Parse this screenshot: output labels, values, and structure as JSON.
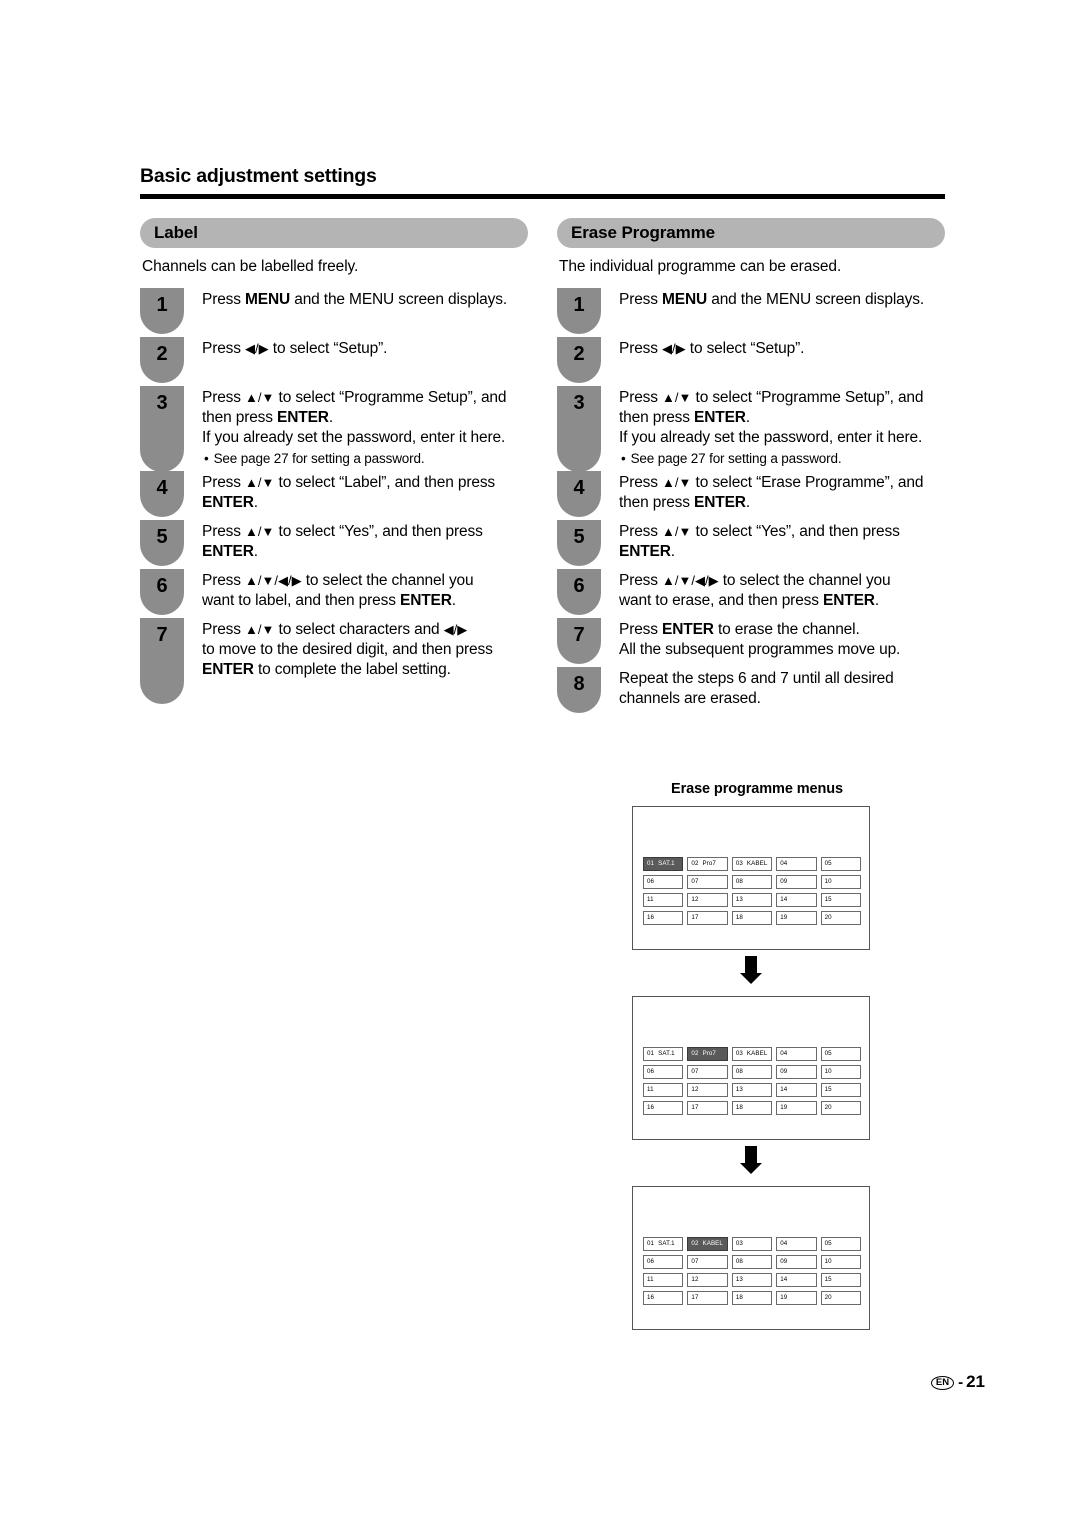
{
  "header": {
    "title": "Basic adjustment settings"
  },
  "left_section": {
    "title": "Label",
    "intro": "Channels can be labelled freely.",
    "steps": [
      {
        "number": "1",
        "size": "sm",
        "lines": [
          [
            {
              "t": "Press ",
              "b": false
            },
            {
              "t": "MENU",
              "b": true
            },
            {
              "t": " and the MENU screen displays.",
              "b": false
            }
          ]
        ]
      },
      {
        "number": "2",
        "size": "sm",
        "lines": [
          [
            {
              "t": "Press ",
              "b": false
            },
            {
              "t": "◀/▶",
              "b": false,
              "arrow": true
            },
            {
              "t": " to select “Setup”.",
              "b": false
            }
          ]
        ]
      },
      {
        "number": "3",
        "size": "lg",
        "lines": [
          [
            {
              "t": "Press ",
              "b": false
            },
            {
              "t": "▲/▼",
              "b": false,
              "arrow": true
            },
            {
              "t": " to select “Programme Setup”, and",
              "b": false
            }
          ],
          [
            {
              "t": "then press ",
              "b": false
            },
            {
              "t": "ENTER",
              "b": true
            },
            {
              "t": ".",
              "b": false
            }
          ],
          [
            {
              "t": "If you already set the password, enter it here.",
              "b": false
            }
          ]
        ],
        "note": "See page 27 for setting a password."
      },
      {
        "number": "4",
        "size": "md",
        "lines": [
          [
            {
              "t": "Press ",
              "b": false
            },
            {
              "t": "▲/▼",
              "b": false,
              "arrow": true
            },
            {
              "t": " to select “Label”, and then press",
              "b": false
            }
          ],
          [
            {
              "t": "ENTER",
              "b": true
            },
            {
              "t": ".",
              "b": false
            }
          ]
        ]
      },
      {
        "number": "5",
        "size": "md",
        "lines": [
          [
            {
              "t": "Press ",
              "b": false
            },
            {
              "t": "▲/▼",
              "b": false,
              "arrow": true
            },
            {
              "t": " to select “Yes”, and then press",
              "b": false
            }
          ],
          [
            {
              "t": "ENTER",
              "b": true
            },
            {
              "t": ".",
              "b": false
            }
          ]
        ]
      },
      {
        "number": "6",
        "size": "md",
        "lines": [
          [
            {
              "t": "Press ",
              "b": false
            },
            {
              "t": "▲/▼/◀/▶",
              "b": false,
              "arrow": true
            },
            {
              "t": " to select the channel you",
              "b": false
            }
          ],
          [
            {
              "t": "want to label, and then press ",
              "b": false
            },
            {
              "t": "ENTER",
              "b": true
            },
            {
              "t": ".",
              "b": false
            }
          ]
        ]
      },
      {
        "number": "7",
        "size": "lg",
        "lines": [
          [
            {
              "t": "Press ",
              "b": false
            },
            {
              "t": "▲/▼",
              "b": false,
              "arrow": true
            },
            {
              "t": " to select characters and ",
              "b": false
            },
            {
              "t": "◀/▶",
              "b": false,
              "arrow": true
            }
          ],
          [
            {
              "t": "to move to the desired digit, and then press",
              "b": false
            }
          ],
          [
            {
              "t": "ENTER",
              "b": true
            },
            {
              "t": " to complete the label setting.",
              "b": false
            }
          ]
        ]
      }
    ]
  },
  "right_section": {
    "title": "Erase Programme",
    "intro": "The individual programme can be erased.",
    "steps": [
      {
        "number": "1",
        "size": "sm",
        "lines": [
          [
            {
              "t": "Press ",
              "b": false
            },
            {
              "t": "MENU",
              "b": true
            },
            {
              "t": " and the MENU screen displays.",
              "b": false
            }
          ]
        ]
      },
      {
        "number": "2",
        "size": "sm",
        "lines": [
          [
            {
              "t": "Press ",
              "b": false
            },
            {
              "t": "◀/▶",
              "b": false,
              "arrow": true
            },
            {
              "t": " to select “Setup”.",
              "b": false
            }
          ]
        ]
      },
      {
        "number": "3",
        "size": "lg",
        "lines": [
          [
            {
              "t": "Press ",
              "b": false
            },
            {
              "t": "▲/▼",
              "b": false,
              "arrow": true
            },
            {
              "t": " to select “Programme Setup”, and",
              "b": false
            }
          ],
          [
            {
              "t": "then press ",
              "b": false
            },
            {
              "t": "ENTER",
              "b": true
            },
            {
              "t": ".",
              "b": false
            }
          ],
          [
            {
              "t": "If you already set the password, enter it here.",
              "b": false
            }
          ]
        ],
        "note": "See page 27 for setting a password."
      },
      {
        "number": "4",
        "size": "md",
        "lines": [
          [
            {
              "t": "Press ",
              "b": false
            },
            {
              "t": "▲/▼",
              "b": false,
              "arrow": true
            },
            {
              "t": " to select “Erase Programme”, and",
              "b": false
            }
          ],
          [
            {
              "t": "then press ",
              "b": false
            },
            {
              "t": "ENTER",
              "b": true
            },
            {
              "t": ".",
              "b": false
            }
          ]
        ]
      },
      {
        "number": "5",
        "size": "md",
        "lines": [
          [
            {
              "t": "Press ",
              "b": false
            },
            {
              "t": "▲/▼",
              "b": false,
              "arrow": true
            },
            {
              "t": " to select “Yes”, and then press",
              "b": false
            }
          ],
          [
            {
              "t": "ENTER",
              "b": true
            },
            {
              "t": ".",
              "b": false
            }
          ]
        ]
      },
      {
        "number": "6",
        "size": "md",
        "lines": [
          [
            {
              "t": "Press ",
              "b": false
            },
            {
              "t": "▲/▼/◀/▶",
              "b": false,
              "arrow": true
            },
            {
              "t": " to select the channel you",
              "b": false
            }
          ],
          [
            {
              "t": "want to erase, and then press ",
              "b": false
            },
            {
              "t": "ENTER",
              "b": true
            },
            {
              "t": ".",
              "b": false
            }
          ]
        ]
      },
      {
        "number": "7",
        "size": "md",
        "lines": [
          [
            {
              "t": "Press ",
              "b": false
            },
            {
              "t": "ENTER",
              "b": true
            },
            {
              "t": " to erase the channel.",
              "b": false
            }
          ],
          [
            {
              "t": "All the subsequent programmes move up.",
              "b": false
            }
          ]
        ]
      },
      {
        "number": "8",
        "size": "md",
        "lines": [
          [
            {
              "t": "Repeat the steps 6 and 7 until all desired",
              "b": false
            }
          ],
          [
            {
              "t": "channels are erased.",
              "b": false
            }
          ]
        ]
      }
    ]
  },
  "diagram": {
    "title": "Erase programme menus",
    "arrow_icon": "down-arrow-icon",
    "menus": [
      {
        "name": "menu-before-erase",
        "rows": [
          [
            {
              "num": "01",
              "nm": "SAT.1",
              "sel": true
            },
            {
              "num": "02",
              "nm": "Pro7",
              "sel": false
            },
            {
              "num": "03",
              "nm": "KABEL",
              "sel": false
            },
            {
              "num": "04",
              "nm": "",
              "sel": false
            },
            {
              "num": "05",
              "nm": "",
              "sel": false
            }
          ],
          [
            {
              "num": "06",
              "nm": "",
              "sel": false
            },
            {
              "num": "07",
              "nm": "",
              "sel": false
            },
            {
              "num": "08",
              "nm": "",
              "sel": false
            },
            {
              "num": "09",
              "nm": "",
              "sel": false
            },
            {
              "num": "10",
              "nm": "",
              "sel": false
            }
          ],
          [
            {
              "num": "11",
              "nm": "",
              "sel": false
            },
            {
              "num": "12",
              "nm": "",
              "sel": false
            },
            {
              "num": "13",
              "nm": "",
              "sel": false
            },
            {
              "num": "14",
              "nm": "",
              "sel": false
            },
            {
              "num": "15",
              "nm": "",
              "sel": false
            }
          ],
          [
            {
              "num": "16",
              "nm": "",
              "sel": false
            },
            {
              "num": "17",
              "nm": "",
              "sel": false
            },
            {
              "num": "18",
              "nm": "",
              "sel": false
            },
            {
              "num": "19",
              "nm": "",
              "sel": false
            },
            {
              "num": "20",
              "nm": "",
              "sel": false
            }
          ]
        ]
      },
      {
        "name": "menu-channel-selected",
        "rows": [
          [
            {
              "num": "01",
              "nm": "SAT.1",
              "sel": false
            },
            {
              "num": "02",
              "nm": "Pro7",
              "sel": true
            },
            {
              "num": "03",
              "nm": "KABEL",
              "sel": false
            },
            {
              "num": "04",
              "nm": "",
              "sel": false
            },
            {
              "num": "05",
              "nm": "",
              "sel": false
            }
          ],
          [
            {
              "num": "06",
              "nm": "",
              "sel": false
            },
            {
              "num": "07",
              "nm": "",
              "sel": false
            },
            {
              "num": "08",
              "nm": "",
              "sel": false
            },
            {
              "num": "09",
              "nm": "",
              "sel": false
            },
            {
              "num": "10",
              "nm": "",
              "sel": false
            }
          ],
          [
            {
              "num": "11",
              "nm": "",
              "sel": false
            },
            {
              "num": "12",
              "nm": "",
              "sel": false
            },
            {
              "num": "13",
              "nm": "",
              "sel": false
            },
            {
              "num": "14",
              "nm": "",
              "sel": false
            },
            {
              "num": "15",
              "nm": "",
              "sel": false
            }
          ],
          [
            {
              "num": "16",
              "nm": "",
              "sel": false
            },
            {
              "num": "17",
              "nm": "",
              "sel": false
            },
            {
              "num": "18",
              "nm": "",
              "sel": false
            },
            {
              "num": "19",
              "nm": "",
              "sel": false
            },
            {
              "num": "20",
              "nm": "",
              "sel": false
            }
          ]
        ]
      },
      {
        "name": "menu-after-erase",
        "rows": [
          [
            {
              "num": "01",
              "nm": "SAT.1",
              "sel": false
            },
            {
              "num": "02",
              "nm": "KABEL",
              "sel": true
            },
            {
              "num": "03",
              "nm": "",
              "sel": false
            },
            {
              "num": "04",
              "nm": "",
              "sel": false
            },
            {
              "num": "05",
              "nm": "",
              "sel": false
            }
          ],
          [
            {
              "num": "06",
              "nm": "",
              "sel": false
            },
            {
              "num": "07",
              "nm": "",
              "sel": false
            },
            {
              "num": "08",
              "nm": "",
              "sel": false
            },
            {
              "num": "09",
              "nm": "",
              "sel": false
            },
            {
              "num": "10",
              "nm": "",
              "sel": false
            }
          ],
          [
            {
              "num": "11",
              "nm": "",
              "sel": false
            },
            {
              "num": "12",
              "nm": "",
              "sel": false
            },
            {
              "num": "13",
              "nm": "",
              "sel": false
            },
            {
              "num": "14",
              "nm": "",
              "sel": false
            },
            {
              "num": "15",
              "nm": "",
              "sel": false
            }
          ],
          [
            {
              "num": "16",
              "nm": "",
              "sel": false
            },
            {
              "num": "17",
              "nm": "",
              "sel": false
            },
            {
              "num": "18",
              "nm": "",
              "sel": false
            },
            {
              "num": "19",
              "nm": "",
              "sel": false
            },
            {
              "num": "20",
              "nm": "",
              "sel": false
            }
          ]
        ]
      }
    ]
  },
  "footer": {
    "language_badge": "EN",
    "dash": "-",
    "page_number": "21"
  },
  "colors": {
    "section_bar": "#b4b4b4",
    "step_badge": "#8c8c8c",
    "cell_selected": "#5a5a5a",
    "rule": "#000000"
  }
}
